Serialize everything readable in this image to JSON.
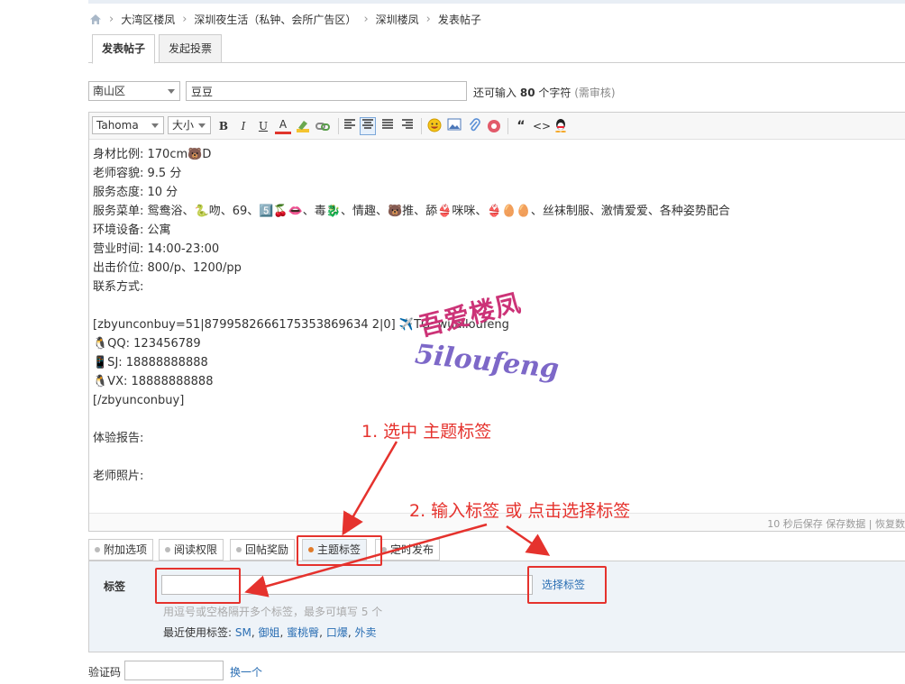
{
  "breadcrumb": {
    "items": [
      "大湾区楼凤",
      "深圳夜生活（私钟、会所广告区）",
      "深圳楼凤",
      "发表帖子"
    ],
    "sep": "›"
  },
  "tabs": [
    "发表帖子",
    "发起投票"
  ],
  "subject": {
    "category": "南山区",
    "title": "豆豆",
    "remain_prefix": "还可输入",
    "remain_count": "80",
    "remain_suffix": "个字符",
    "review_note": "(需审核)"
  },
  "toolbar": {
    "font": "Tahoma",
    "size": "大小",
    "bold": "B",
    "italic": "I",
    "underline": "U",
    "color": "A",
    "quote": "“",
    "code": "<>"
  },
  "content_lines": [
    "身材比例:  170cm🐻D",
    "老师容貌:   9.5 分",
    "服务态度:   10 分",
    "服务菜单:   鸳鸯浴、🐍吻、69、5️⃣🍒👄、毒🐉、情趣、🐻推、舔👙咪咪、👙🥚🥚、丝袜制服、激情爱爱、各种姿势配合",
    "环境设备:   公寓",
    "营业时间:  14:00-23:00",
    "出击价位:   800/p、1200/pp",
    "联系方式:",
    "",
    "[zbyunconbuy=51|8799582666175353869634 2|0] ✈️TG:  wualloufeng",
    "🐧QQ: 123456789",
    "📱SJ: 18888888888",
    "🐧VX: 18888888888",
    "[/zbyunconbuy]",
    "",
    "体验报告:",
    "",
    "老师照片:"
  ],
  "autosave": "10 秒后保存 保存数据 | 恢复数",
  "watermark": {
    "line1": "吾爱楼凤",
    "line2": "5iloufeng"
  },
  "option_tabs": [
    "附加选项",
    "阅读权限",
    "回帖奖励",
    "主题标签",
    "定时发布"
  ],
  "active_option_tab": "主题标签",
  "tag_panel": {
    "label": "标签",
    "input_value": "",
    "select_link": "选择标签",
    "hint": "用逗号或空格隔开多个标签，最多可填写 5 个",
    "recent_label": "最近使用标签:",
    "recent_tags": [
      "SM",
      "御姐",
      "蜜桃臀",
      "口爆",
      "外卖"
    ]
  },
  "captcha": {
    "label": "验证码",
    "change": "换一个"
  },
  "annotations": {
    "step1": "1. 选中 主题标签",
    "step2": "2. 输入标签 或 点击选择标签"
  },
  "colors": {
    "annotation": "#e5322d",
    "link": "#2a6eb3",
    "panel_bg": "#eef3f8"
  }
}
